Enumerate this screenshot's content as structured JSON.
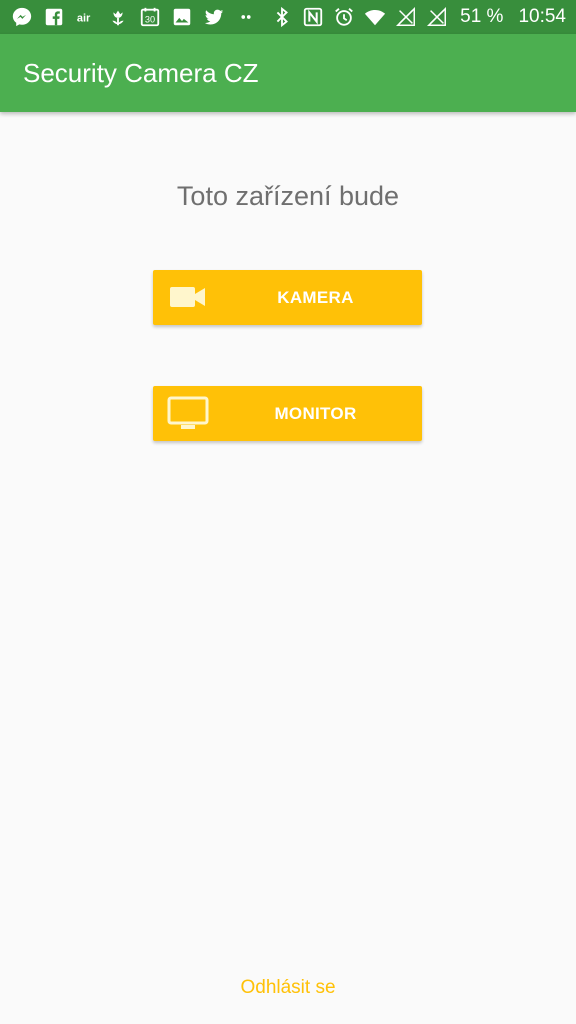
{
  "status_bar": {
    "icons": [
      "messenger-icon",
      "facebook-icon",
      "air-icon",
      "tulip-icon",
      "calendar-icon",
      "image-icon",
      "twitter-icon",
      "more-dots-icon",
      "bluetooth-icon",
      "nfc-icon",
      "alarm-icon",
      "wifi-icon",
      "signal-icon",
      "signal-icon"
    ],
    "calendar_day": "30",
    "air_label": "air",
    "battery": "51 %",
    "time": "10:54"
  },
  "app_bar": {
    "title": "Security Camera CZ"
  },
  "main": {
    "prompt": "Toto zařízení bude",
    "camera_button": {
      "label": "KAMERA",
      "icon": "video-camera-icon"
    },
    "monitor_button": {
      "label": "MONITOR",
      "icon": "monitor-icon"
    }
  },
  "footer": {
    "logout_label": "Odhlásit se"
  },
  "colors": {
    "status_bar": "#388e3c",
    "app_bar": "#4caf50",
    "accent": "#ffc107",
    "background": "#fafafa"
  }
}
